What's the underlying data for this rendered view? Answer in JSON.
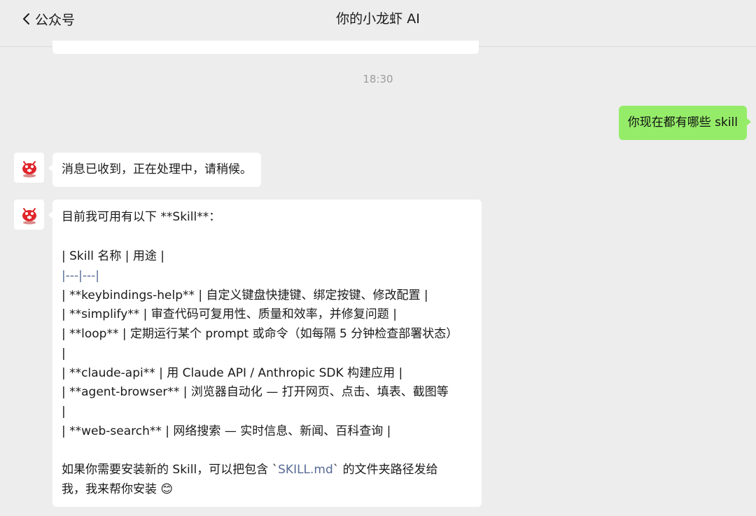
{
  "header": {
    "back_label": "公众号",
    "title": "你的小龙虾 AI"
  },
  "timestamp": "18:30",
  "messages": {
    "user_1": "你现在都有哪些 skill",
    "bot_1": "消息已收到，正在处理中，请稍候。",
    "bot_2": {
      "lines": [
        "目前我可用有以下 **Skill**：",
        "| Skill 名称 | 用途 |",
        "|---|---|",
        "| **keybindings-help** | 自定义键盘快捷键、绑定按键、修改配置 |",
        "| **simplify** | 审查代码可复用性、质量和效率，并修复问题 |",
        "| **loop** | 定期运行某个 prompt 或命令（如每隔 5 分钟检查部署状态）",
        "|",
        "| **claude-api** | 用 Claude API / Anthropic SDK 构建应用 |",
        "| **agent-browser** | 浏览器自动化 — 打开网页、点击、填表、截图等",
        "|",
        "| **web-search** | 网络搜索 — 实时信息、新闻、百科查询 |"
      ],
      "footer_1_pre": "如果你需要安装新的 Skill，可以把包含 `",
      "footer_1_code": "SKILL.md",
      "footer_1_post": "` 的文件夹路径发给",
      "footer_2": "我，我来帮你安装 😊"
    }
  },
  "colors": {
    "user_bubble": "#95ec69",
    "bot_bubble": "#ffffff",
    "background": "#ededed",
    "link": "#576b95",
    "avatar_red": "#e0262c"
  },
  "icons": {
    "back": "chevron-left-icon",
    "avatar": "lobster-robot-avatar-icon"
  }
}
